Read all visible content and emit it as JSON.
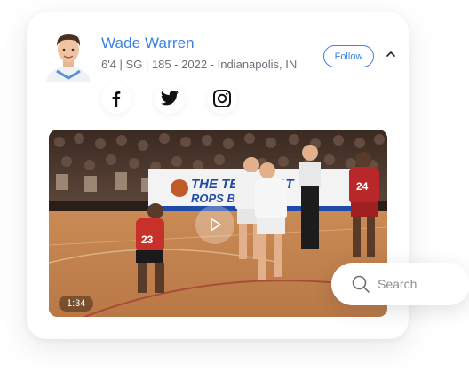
{
  "profile": {
    "name": "Wade Warren",
    "meta": "6'4 | SG | 185 - 2022 - Indianapolis, IN",
    "follow_label": "Follow"
  },
  "social": [
    {
      "icon": "facebook-icon"
    },
    {
      "icon": "twitter-icon"
    },
    {
      "icon": "instagram-icon"
    }
  ],
  "video": {
    "duration": "1:34",
    "banner_line1": "THE TEMPERAT",
    "banner_line2": "ROPS BELO",
    "jersey_left": "23",
    "jersey_right": "24"
  },
  "search": {
    "placeholder": "Search"
  },
  "colors": {
    "accent": "#3b82e6",
    "meta_text": "#6b6f78"
  }
}
